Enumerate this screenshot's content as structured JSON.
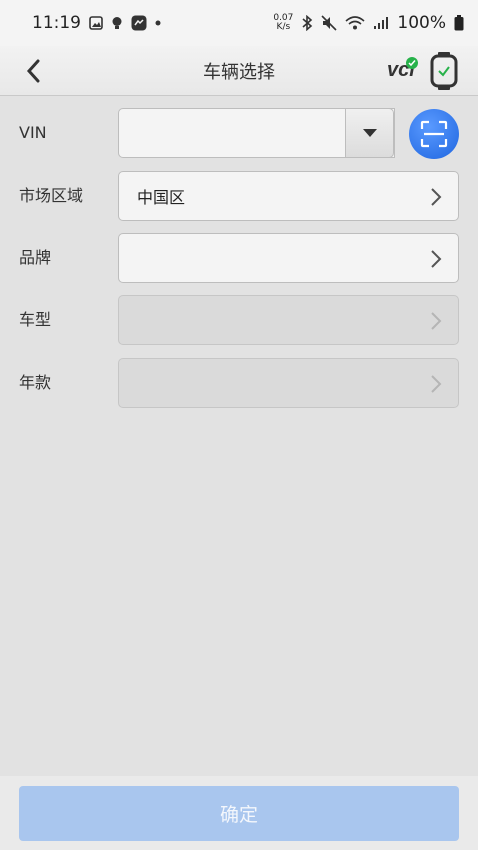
{
  "status_bar": {
    "time": "11:19",
    "net_speed_value": "0.07",
    "net_speed_unit": "K/s",
    "battery": "100%",
    "icons": [
      "gallery-icon",
      "bulb-icon",
      "app-icon",
      "dot-icon",
      "bluetooth-icon",
      "mute-icon",
      "wifi-icon",
      "signal-icon",
      "battery-icon"
    ]
  },
  "header": {
    "title": "车辆选择",
    "vci_label": "vci"
  },
  "form": {
    "vin_label": "VIN",
    "vin_value": "",
    "market_label": "市场区域",
    "market_value": "中国区",
    "brand_label": "品牌",
    "brand_value": "",
    "model_label": "车型",
    "model_value": "",
    "year_label": "年款",
    "year_value": ""
  },
  "footer": {
    "confirm_label": "确定"
  },
  "colors": {
    "scan_button": "#2f78ea",
    "confirm_button": "#a9c6ee",
    "vci_status": "#27b24a"
  }
}
